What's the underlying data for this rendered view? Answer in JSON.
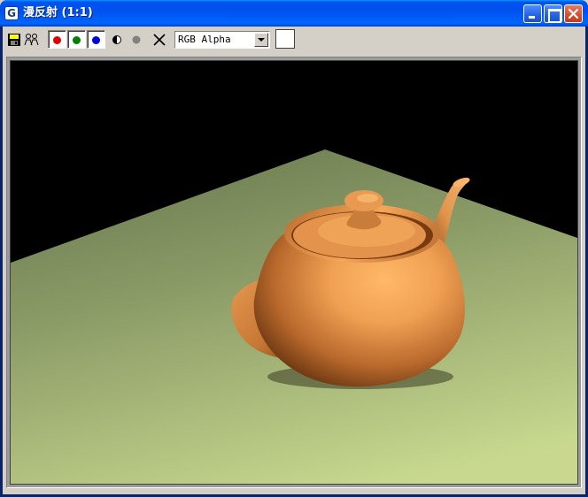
{
  "window": {
    "title": "漫反射  (1:1)",
    "app_icon_glyph": "G"
  },
  "toolbar": {
    "items": [
      {
        "name": "save-icon"
      },
      {
        "name": "clone-icon"
      },
      {
        "name": "red-channel",
        "color": "#e00000"
      },
      {
        "name": "green-channel",
        "color": "#008000"
      },
      {
        "name": "blue-channel",
        "color": "#0000e0"
      },
      {
        "name": "monochrome-icon"
      },
      {
        "name": "alpha-channel-icon"
      },
      {
        "name": "clear-icon"
      }
    ],
    "channel_select": {
      "value": "RGB Alpha"
    },
    "color_swatch": "#ffffff"
  },
  "render": {
    "background": "#000000",
    "floor_color_far": "#7b8c5c",
    "floor_color_near": "#c5d68e",
    "teapot_color": "#e8944a"
  }
}
